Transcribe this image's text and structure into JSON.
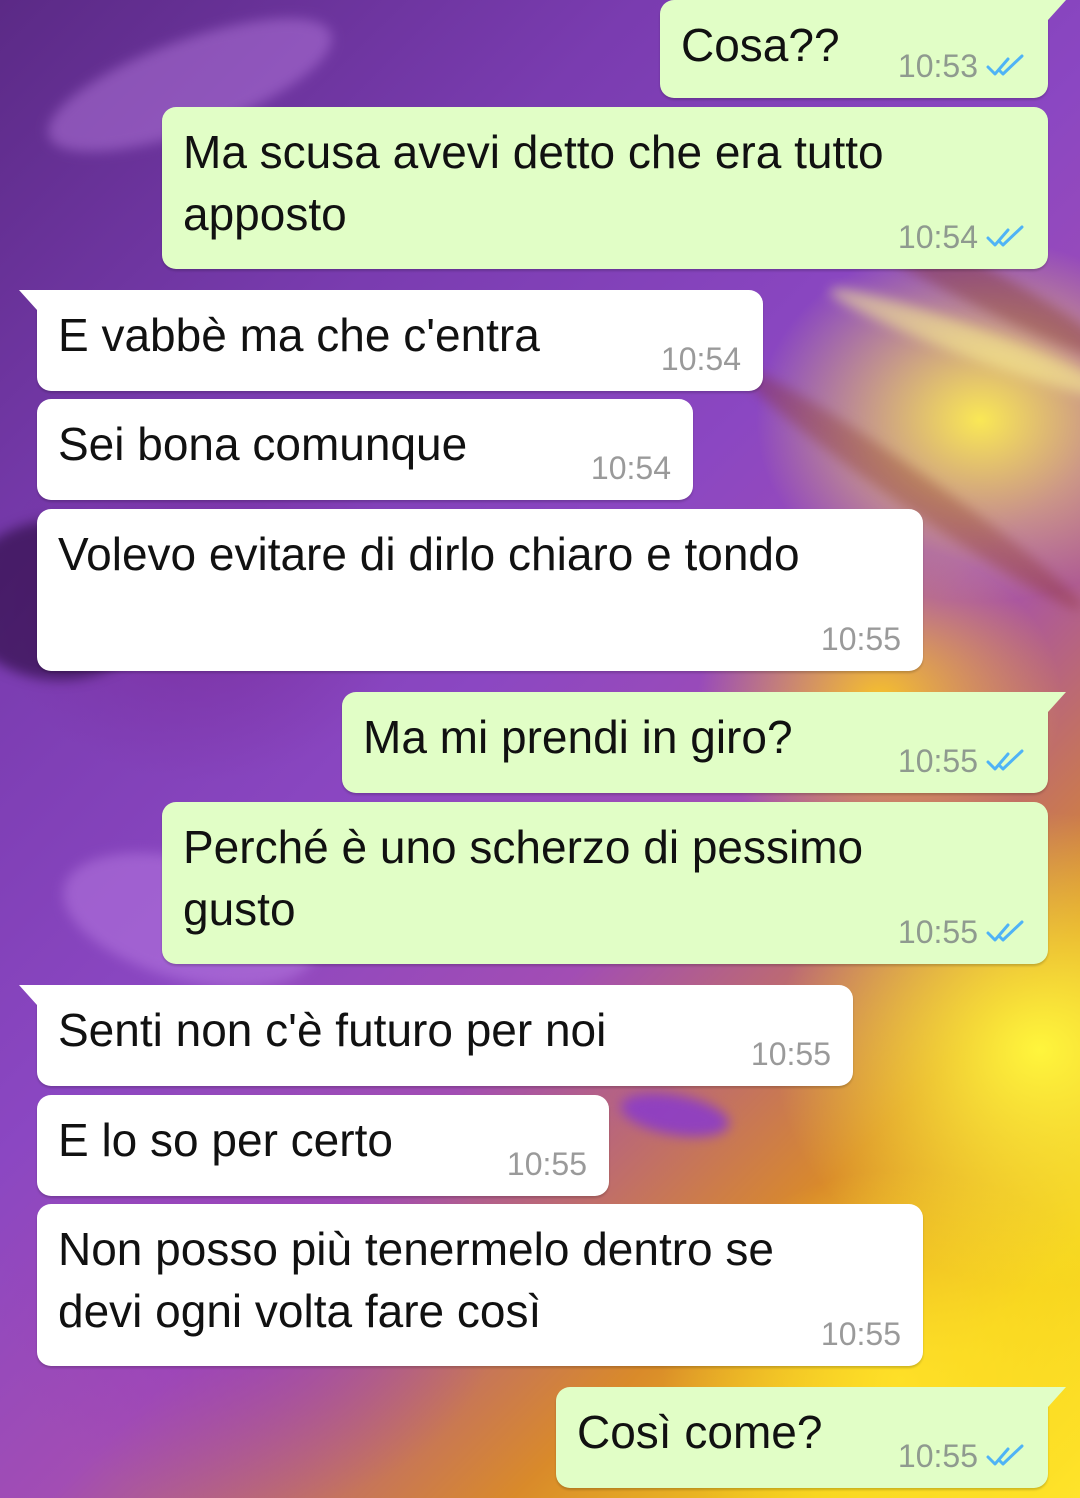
{
  "colors": {
    "outgoing_bubble": "#e1fec6",
    "incoming_bubble": "#ffffff",
    "read_check": "#4fb3f6"
  },
  "messages": [
    {
      "direction": "out",
      "text": "Cosa??",
      "time": "10:53",
      "status_icon": "double-check-read-icon"
    },
    {
      "direction": "out",
      "text": "Ma scusa avevi detto che era tutto\napposto",
      "time": "10:54",
      "status_icon": "double-check-read-icon"
    },
    {
      "direction": "in",
      "text": "E vabbè ma che c'entra",
      "time": "10:54"
    },
    {
      "direction": "in",
      "text": "Sei bona comunque",
      "time": "10:54"
    },
    {
      "direction": "in",
      "text": "Volevo evitare di dirlo chiaro e tondo",
      "time": "10:55"
    },
    {
      "direction": "out",
      "text": "Ma mi prendi in giro?",
      "time": "10:55",
      "status_icon": "double-check-read-icon"
    },
    {
      "direction": "out",
      "text": "Perché è uno scherzo di pessimo\ngusto",
      "time": "10:55",
      "status_icon": "double-check-read-icon"
    },
    {
      "direction": "in",
      "text": "Senti non c'è futuro per noi",
      "time": "10:55"
    },
    {
      "direction": "in",
      "text": "E lo so per certo",
      "time": "10:55"
    },
    {
      "direction": "in",
      "text": "Non posso più tenermelo dentro se\ndevi ogni volta fare così",
      "time": "10:55"
    },
    {
      "direction": "out",
      "text": "Così come?",
      "time": "10:55",
      "status_icon": "double-check-read-icon"
    }
  ]
}
